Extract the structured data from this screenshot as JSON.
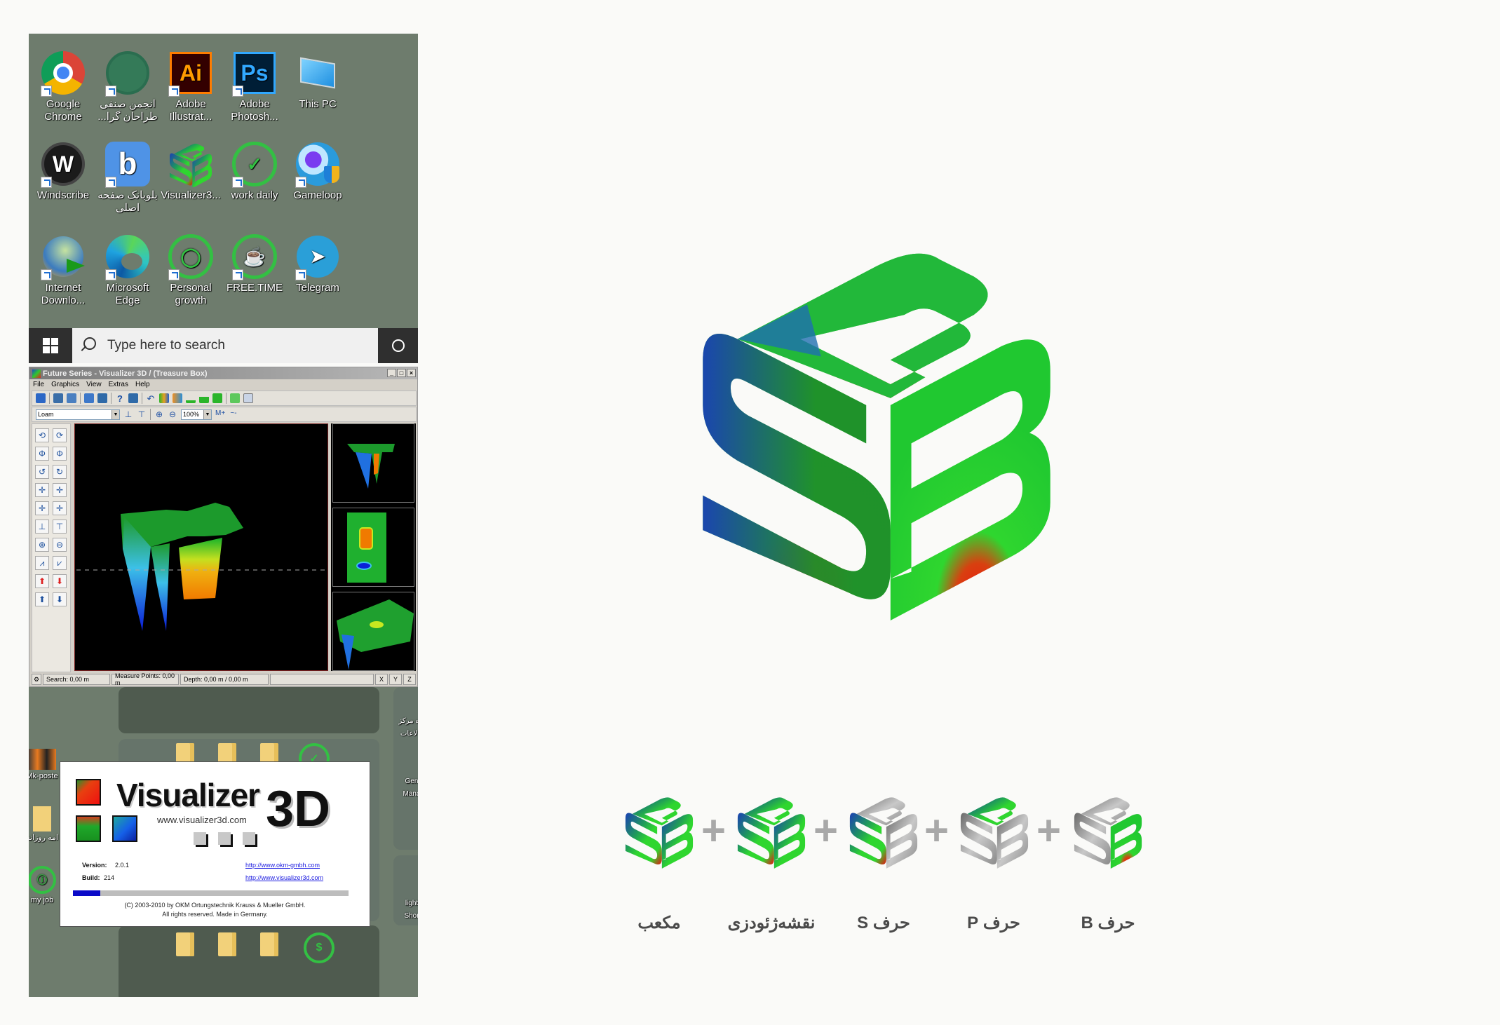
{
  "desktop": {
    "icons": [
      {
        "label": "Google Chrome",
        "icon": "chrome-icon"
      },
      {
        "label": "انجمن صنفی طراحان گرا...",
        "icon": "association-icon"
      },
      {
        "label": "Adobe Illustrat...",
        "icon": "illustrator-icon",
        "glyph": "Ai"
      },
      {
        "label": "Adobe Photosh...",
        "icon": "photoshop-icon",
        "glyph": "Ps"
      },
      {
        "label": "This PC",
        "icon": "computer-icon"
      },
      {
        "label": "Windscribe",
        "icon": "windscribe-icon",
        "glyph": "W"
      },
      {
        "label": "بلوبانک صفحه اصلی",
        "icon": "blubank-icon",
        "glyph": "b"
      },
      {
        "label": "Visualizer3...",
        "icon": "visualizer-icon"
      },
      {
        "label": "work daily",
        "icon": "work-daily-icon"
      },
      {
        "label": "Gameloop",
        "icon": "gameloop-icon"
      },
      {
        "label": "Internet Downlo...",
        "icon": "idm-icon"
      },
      {
        "label": "Microsoft Edge",
        "icon": "edge-icon"
      },
      {
        "label": "Personal growth",
        "icon": "personal-growth-icon"
      },
      {
        "label": "FREE.TIME",
        "icon": "free-time-icon"
      },
      {
        "label": "Telegram",
        "icon": "telegram-icon"
      }
    ]
  },
  "taskbar": {
    "search_placeholder": "Type here to search",
    "start_icon": "windows-logo-icon",
    "cortana_icon": "cortana-circle-icon"
  },
  "visualizer": {
    "title": "Future Series - Visualizer 3D / (Treasure Box)",
    "window_buttons": [
      "_",
      "□",
      "×"
    ],
    "menu": [
      "File",
      "Graphics",
      "View",
      "Extras",
      "Help"
    ],
    "material_select": "Loam",
    "zoom_select": "100%",
    "status": {
      "search": "Search: 0,00 m",
      "measure_points": "Measure Points: 0,00 m",
      "depth": "Depth: 0,00 m / 0,00 m",
      "axes": [
        "X",
        "Y",
        "Z"
      ]
    }
  },
  "desktop2": {
    "icons": [
      {
        "label": "Mk-poste",
        "icon": "poster-icon"
      },
      {
        "label": "امه روزانه",
        "icon": "folder-icon"
      },
      {
        "label": "my job",
        "icon": "my-job-icon"
      },
      {
        "label": "ه مرکز لاعات",
        "icon": "shortcut-icon"
      },
      {
        "label": "Gen Mana",
        "icon": "shortcut-icon"
      },
      {
        "label": "light Shor",
        "icon": "folder-icon"
      }
    ]
  },
  "splash": {
    "title": "Visualizer",
    "title_suffix": "3D",
    "url": "www.visualizer3d.com",
    "version_label": "Version:",
    "version": "2.0.1",
    "build_label": "Build:",
    "build": "214",
    "links": [
      "http://www.okm-gmbh.com",
      "http://www.visualizer3d.com"
    ],
    "progress": 0.1,
    "copyright": "(C) 2003-2010 by OKM Ortungstechnik Krauss & Mueller GmbH.",
    "rights": "All rights reserved.  Made in Germany."
  },
  "logo": {
    "name": "SPB cube logo",
    "colors": {
      "blue": "#1a3fb5",
      "green": "#2fd62f",
      "dark_green": "#1f8f2a",
      "red": "#e81010",
      "gray": "#9a9a9a"
    }
  },
  "breakdown": {
    "operator": "+",
    "items": [
      {
        "label": "مکعب",
        "variant": "full-color"
      },
      {
        "label": "نقشه‌ژئودزی",
        "variant": "full-color"
      },
      {
        "label": "حرف S",
        "variant": "s-highlight"
      },
      {
        "label": "حرف P",
        "variant": "p-highlight"
      },
      {
        "label": "حرف B",
        "variant": "b-highlight"
      }
    ]
  }
}
